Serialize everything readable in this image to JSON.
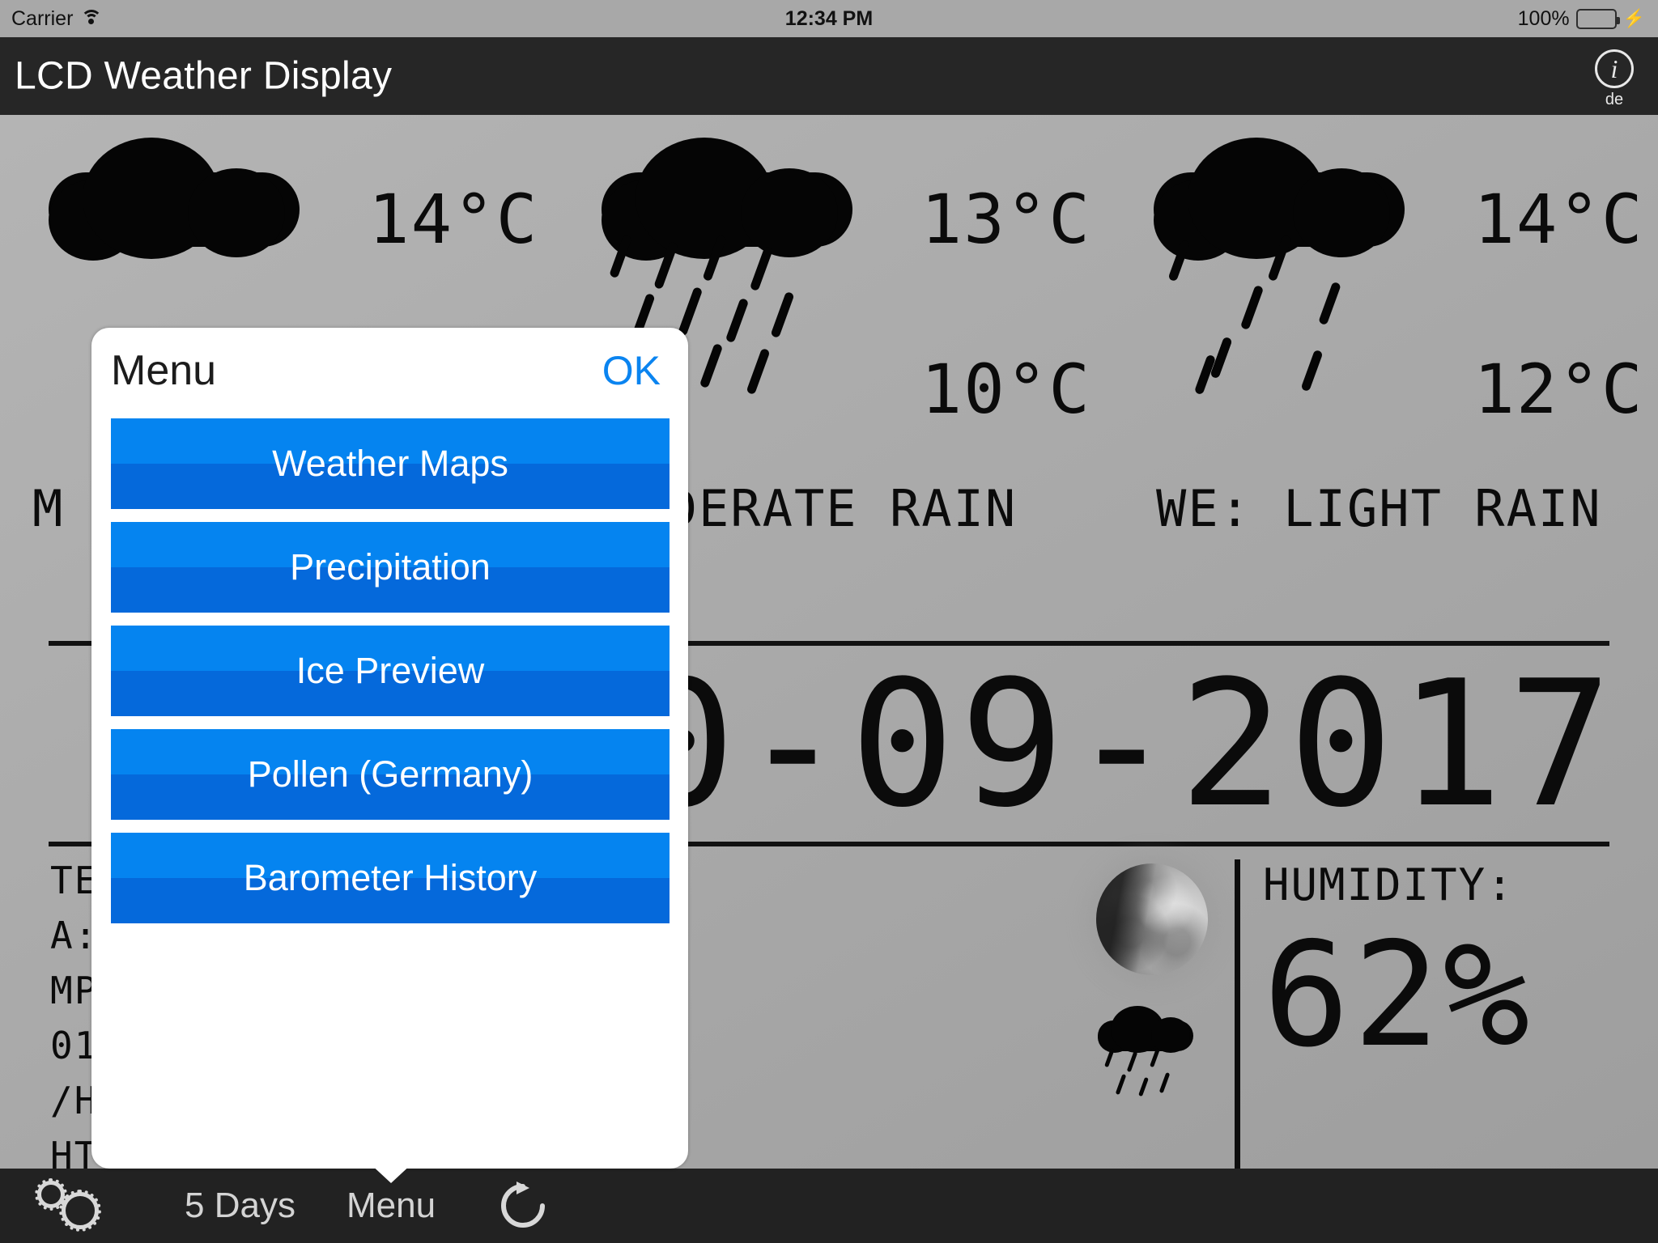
{
  "status_bar": {
    "carrier": "Carrier",
    "wifi_icon": "wifi-icon",
    "time": "12:34 PM",
    "battery_percent": "100%",
    "battery_icon": "battery-icon",
    "charging_icon": "lightning-bolt-icon"
  },
  "title_bar": {
    "title": "LCD Weather Display",
    "info_icon_glyph": "i",
    "info_icon": "info-circle-icon",
    "language_label": "de"
  },
  "lcd": {
    "forecast": [
      {
        "day_prefix": "M",
        "icon": "cloud-icon",
        "high": "14°C",
        "low": "",
        "description": "M"
      },
      {
        "day_prefix": "",
        "icon": "cloud-rain-icon",
        "high": "13°C",
        "low": "10°C",
        "description": "MODERATE RAIN"
      },
      {
        "day_prefix": "WE",
        "icon": "cloud-rain-icon",
        "high": "14°C",
        "low": "12°C",
        "description": "WE: LIGHT RAIN"
      }
    ],
    "date": "10-09-2017",
    "info_lines": [
      "TEMPERATURE",
      "A: 2017-10-09 12:34",
      "MPERATURE: 8°C",
      "016 MB",
      "/H W",
      "HT RAIN"
    ],
    "moon_icon": "moon-phase-icon",
    "condition_icon": "cloud-rain-icon",
    "humidity_label": "HUMIDITY:",
    "humidity_value": "62%"
  },
  "popover": {
    "title": "Menu",
    "ok_label": "OK",
    "items": [
      {
        "label": "Weather Maps"
      },
      {
        "label": "Precipitation"
      },
      {
        "label": "Ice Preview"
      },
      {
        "label": "Pollen (Germany)"
      },
      {
        "label": "Barometer History"
      }
    ]
  },
  "toolbar": {
    "settings_icon": "gears-icon",
    "five_days_label": "5 Days",
    "menu_label": "Menu",
    "refresh_icon": "refresh-icon"
  },
  "colors": {
    "accent_blue": "#0a84f0",
    "button_blue_top": "#0584f0",
    "button_blue_bottom": "#0569db",
    "titlebar_bg": "#262626",
    "toolbar_bg": "#222222",
    "lcd_bg": "#aaaaaa",
    "battery_green": "#4cd964"
  }
}
